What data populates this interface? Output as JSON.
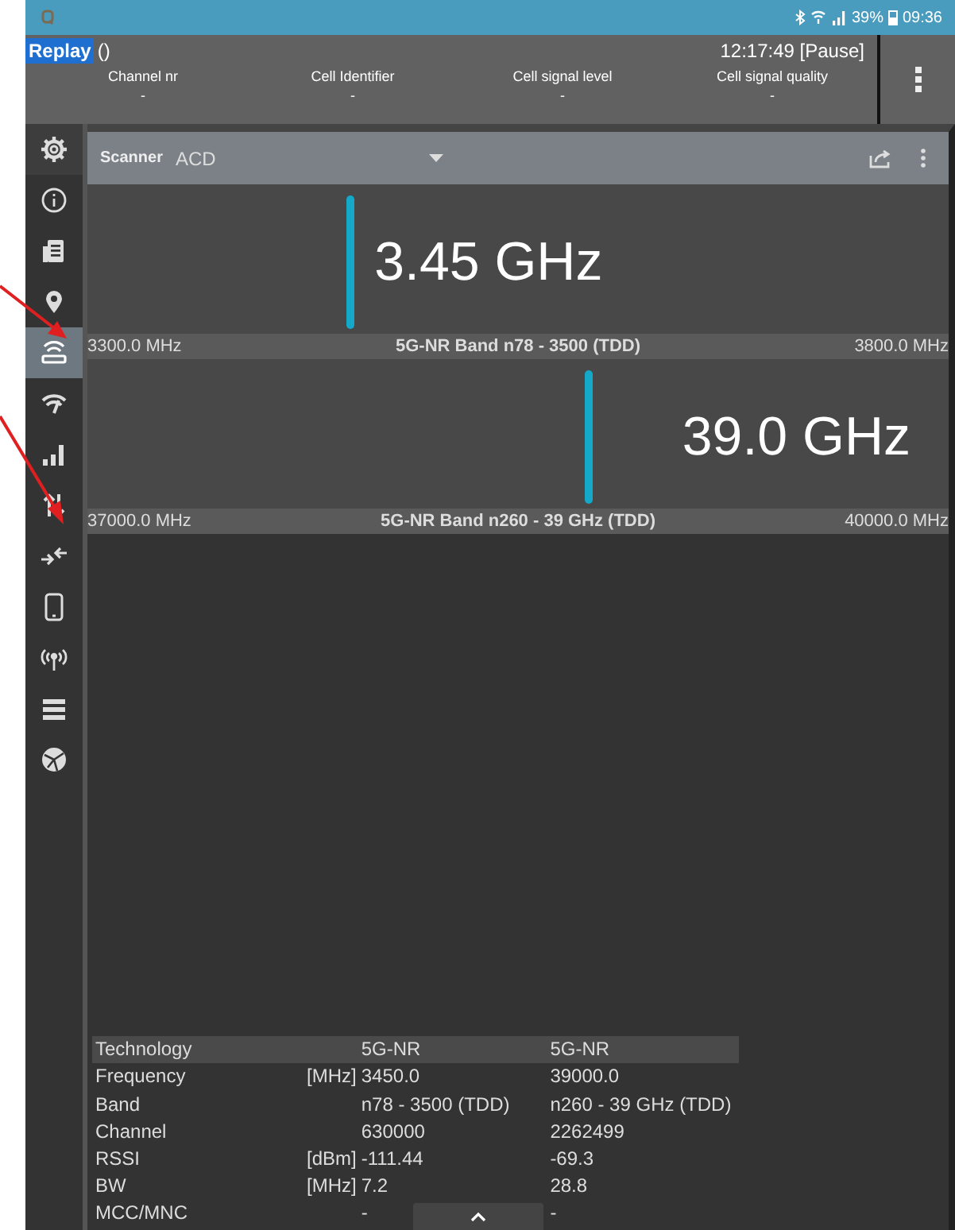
{
  "status_bar": {
    "battery": "39%",
    "time": "09:36"
  },
  "header": {
    "mode": "Replay",
    "mode_suffix": "()",
    "clock": "12:17:49 [Pause]",
    "columns": [
      {
        "label": "Channel nr",
        "value": "-"
      },
      {
        "label": "Cell Identifier",
        "value": "-"
      },
      {
        "label": "Cell signal level",
        "value": "-"
      },
      {
        "label": "Cell signal quality",
        "value": "-"
      }
    ]
  },
  "sidebar": {
    "items": [
      {
        "kind": "gear",
        "selected": false
      },
      {
        "kind": "info",
        "selected": false
      },
      {
        "kind": "document",
        "selected": false
      },
      {
        "kind": "pin",
        "selected": false
      },
      {
        "kind": "router",
        "selected": true
      },
      {
        "kind": "wifi",
        "selected": false
      },
      {
        "kind": "bars",
        "selected": false
      },
      {
        "kind": "updown",
        "selected": false
      },
      {
        "kind": "merge",
        "selected": false
      },
      {
        "kind": "phone",
        "selected": false
      },
      {
        "kind": "antenna",
        "selected": false
      },
      {
        "kind": "menu",
        "selected": false
      },
      {
        "kind": "ball",
        "selected": false
      }
    ]
  },
  "scanner": {
    "title": "Scanner",
    "mode": "ACD",
    "bands": [
      {
        "reading": "3.45 GHz",
        "level": 0.3,
        "low": "3300.0 MHz",
        "name": "5G-NR Band n78 - 3500 (TDD)",
        "high": "3800.0 MHz"
      },
      {
        "reading": "39.0 GHz",
        "level": 0.577,
        "low": "37000.0 MHz",
        "name": "5G-NR Band n260 - 39 GHz (TDD)",
        "high": "40000.0 MHz"
      }
    ]
  },
  "table": {
    "rows": [
      {
        "label": "Technology",
        "unit": "",
        "values": [
          "5G-NR",
          "5G-NR"
        ]
      },
      {
        "label": "Frequency",
        "unit": "[MHz]",
        "values": [
          "3450.0",
          "39000.0"
        ]
      },
      {
        "label": "Band",
        "unit": "",
        "values": [
          "n78 - 3500 (TDD)",
          "n260 - 39 GHz (TDD)"
        ]
      },
      {
        "label": "Channel",
        "unit": "",
        "values": [
          "630000",
          "2262499"
        ]
      },
      {
        "label": "RSSI",
        "unit": "[dBm]",
        "values": [
          "-111.44",
          "-69.3"
        ]
      },
      {
        "label": "BW",
        "unit": "[MHz]",
        "values": [
          "7.2",
          "28.8"
        ]
      },
      {
        "label": "MCC/MNC",
        "unit": "",
        "values": [
          "-",
          "-"
        ]
      }
    ]
  }
}
